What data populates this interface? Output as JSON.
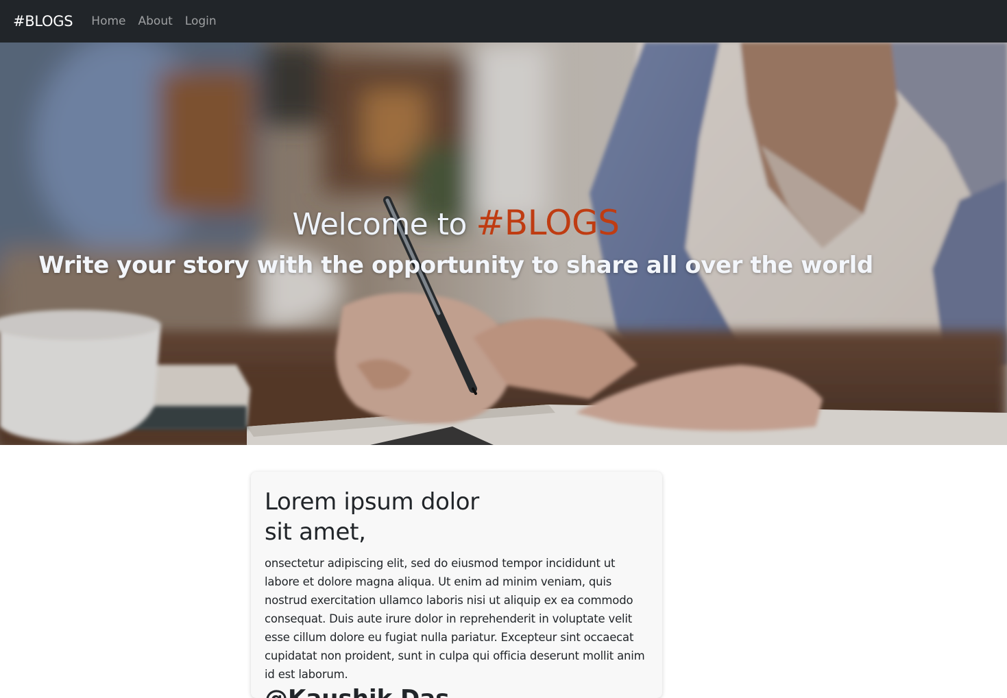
{
  "navbar": {
    "brand": "#BLOGS",
    "links": [
      {
        "label": "Home"
      },
      {
        "label": "About"
      },
      {
        "label": "Login"
      }
    ],
    "background": "#212529"
  },
  "hero": {
    "title_prefix": "Welcome to ",
    "title_accent": "#BLOGS",
    "subtitle": "Write your story with the opportunity to share all over the world",
    "accent_color": "#bf3c12"
  },
  "card": {
    "title": "Lorem ipsum dolor sit amet,",
    "body": "onsectetur adipiscing elit, sed do eiusmod tempor incididunt ut labore et dolore magna aliqua. Ut enim ad minim veniam, quis nostrud exercitation ullamco laboris nisi ut aliquip ex ea commodo consequat. Duis aute irure dolor in reprehenderit in voluptate velit esse cillum dolore eu fugiat nulla pariatur. Excepteur sint occaecat cupidatat non proident, sunt in culpa qui officia deserunt mollit anim id est laborum.",
    "author": "@Kaushik Das"
  }
}
